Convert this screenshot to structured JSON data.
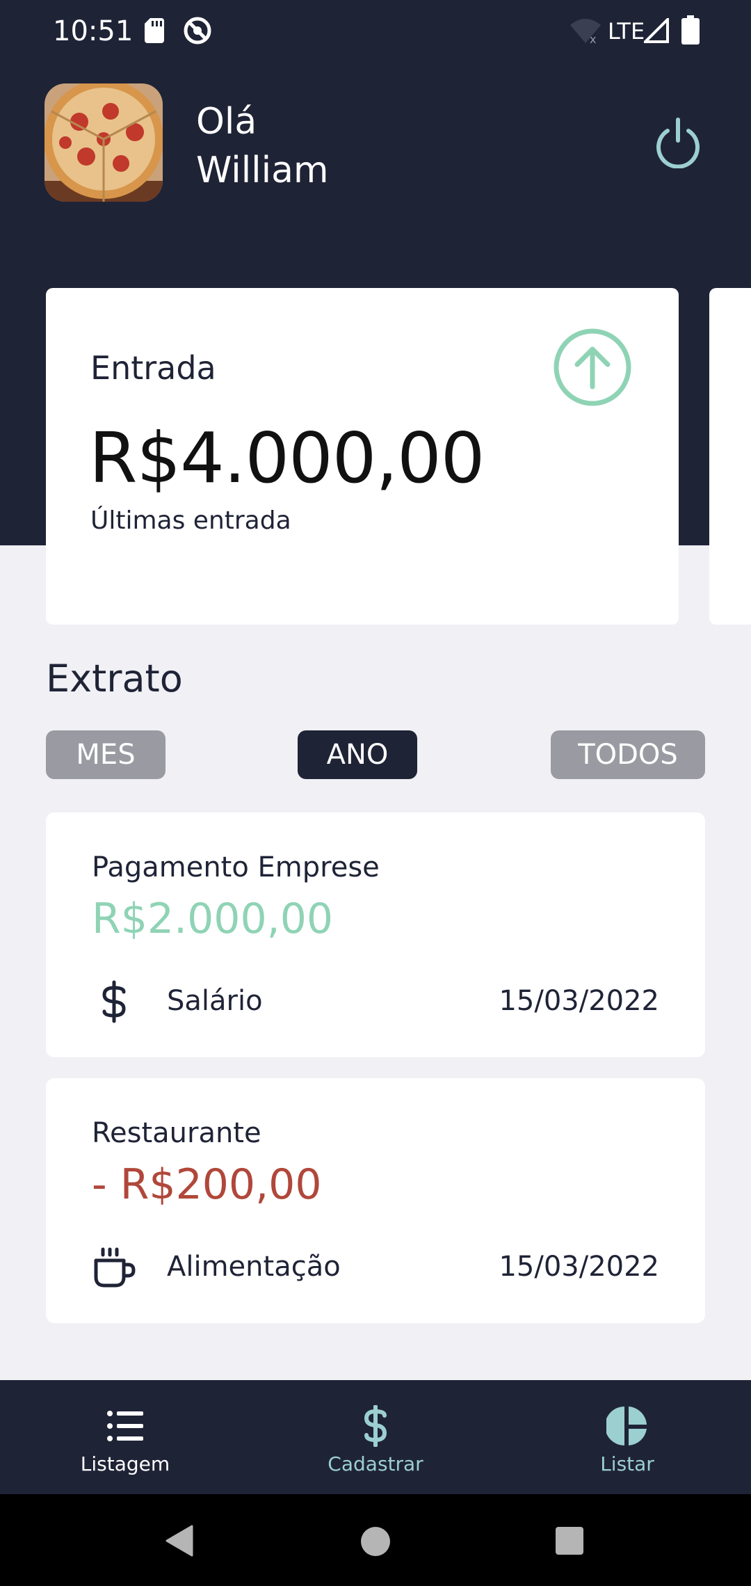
{
  "status_bar": {
    "time": "10:51",
    "network": "LTE",
    "icons": [
      "sd-card-icon",
      "sync-disabled-icon",
      "wifi-off-icon",
      "signal-icon",
      "battery-icon"
    ]
  },
  "profile": {
    "greeting": "Olá",
    "name": "William",
    "avatar_icon": "pizza-photo",
    "logout_icon": "power-icon"
  },
  "summary_card": {
    "label": "Entrada",
    "value": "R$4.000,00",
    "subtitle": "Últimas entrada",
    "icon": "arrow-up-circle-icon",
    "accent_color": "#8fd3b5"
  },
  "extrato": {
    "title": "Extrato",
    "filters": [
      {
        "label": "MES",
        "active": false
      },
      {
        "label": "ANO",
        "active": true
      },
      {
        "label": "TODOS",
        "active": false
      }
    ],
    "transactions": [
      {
        "title": "Pagamento Emprese",
        "amount": "R$2.000,00",
        "amount_color": "#8fd3b5",
        "category": "Salário",
        "category_icon": "dollar-icon",
        "date": "15/03/2022"
      },
      {
        "title": "Restaurante",
        "amount": "- R$200,00",
        "amount_color": "#b0473a",
        "category": "Alimentação",
        "category_icon": "coffee-cup-icon",
        "date": "15/03/2022"
      }
    ]
  },
  "bottom_nav": {
    "items": [
      {
        "label": "Listagem",
        "icon": "list-icon",
        "active": true
      },
      {
        "label": "Cadastrar",
        "icon": "dollar-icon",
        "active": false
      },
      {
        "label": "Listar",
        "icon": "pie-chart-icon",
        "active": false
      }
    ],
    "active_color": "#ffffff",
    "inactive_color": "#9ccfd0"
  },
  "system_nav": {
    "icons": [
      "back-icon",
      "home-icon",
      "recents-icon"
    ]
  }
}
